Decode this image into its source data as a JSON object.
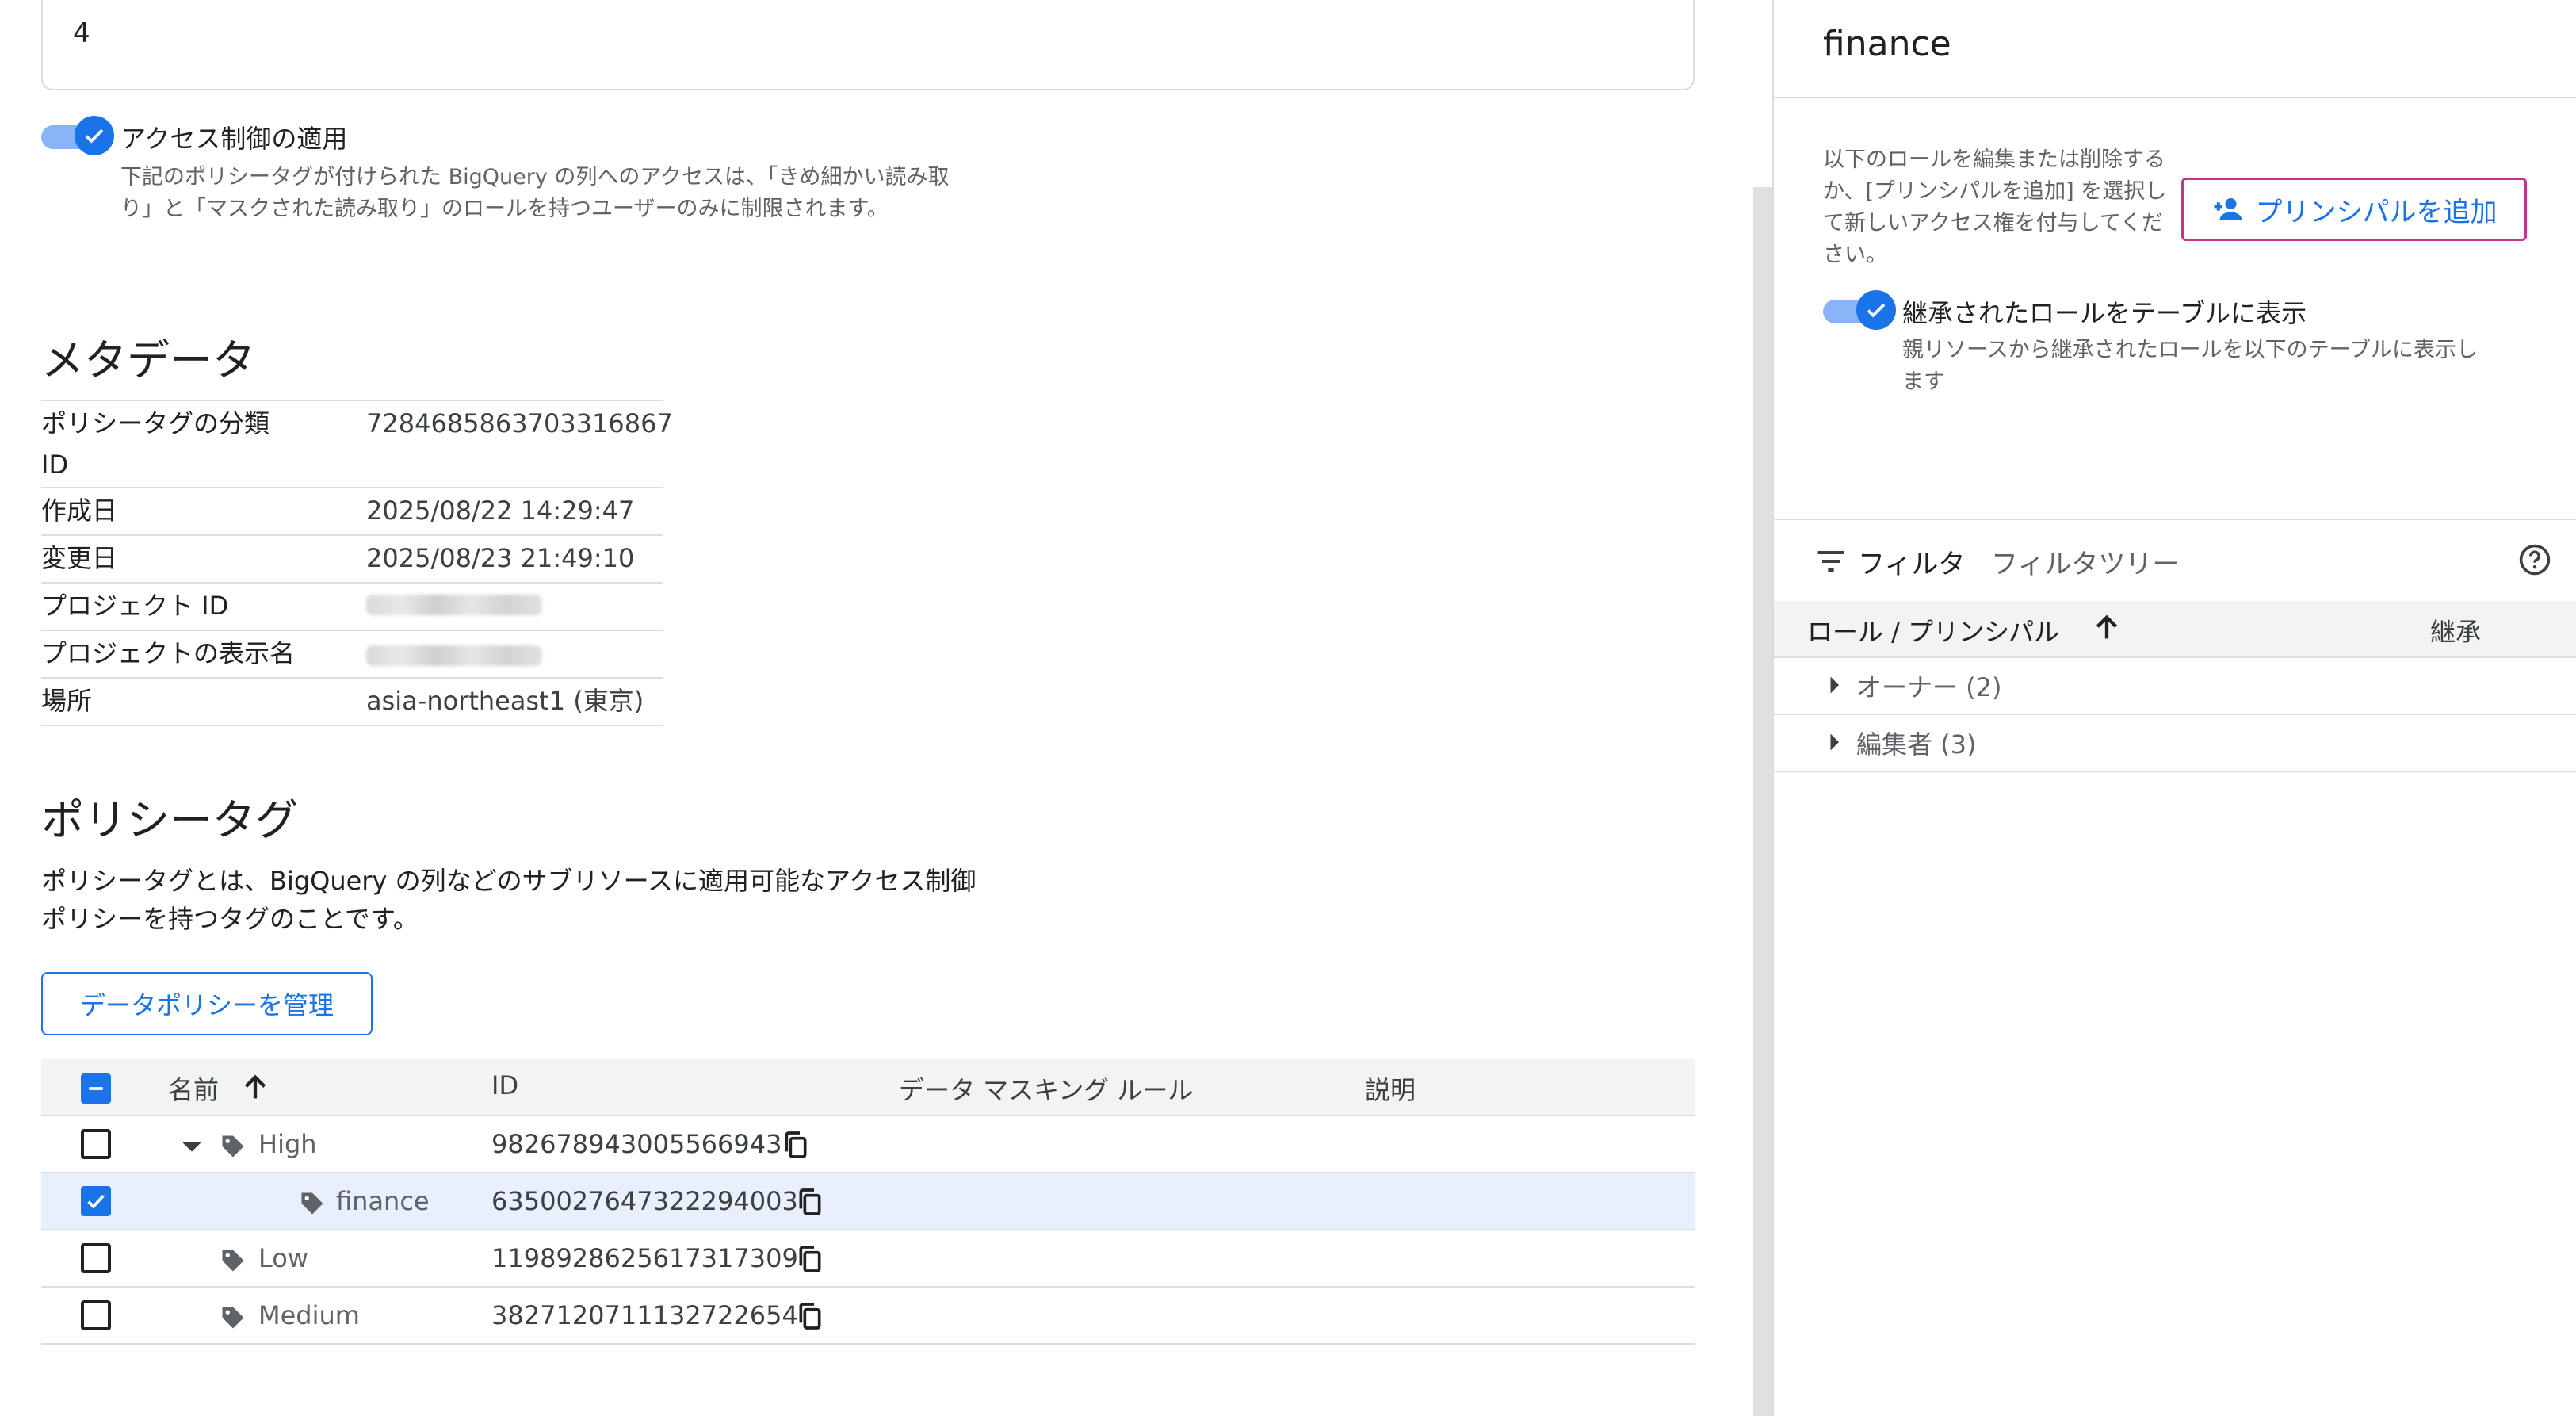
{
  "top_input": {
    "value": "4"
  },
  "access_control": {
    "title": "アクセス制御の適用",
    "description_line1": "下記のポリシータグが付けられた BigQuery の列へのアクセスは、「きめ細かい読み取",
    "description_line2": "り」と「マスクされた読み取り」のロールを持つユーザーのみに制限されます。",
    "enabled": true
  },
  "metadata": {
    "heading": "メタデータ",
    "rows": [
      {
        "key": "ポリシータグの分類",
        "key2": "ID",
        "value": "7284685863703316867"
      },
      {
        "key": "作成日",
        "value": "2025/08/22 14:29:47"
      },
      {
        "key": "変更日",
        "value": "2025/08/23 21:49:10"
      },
      {
        "key": "プロジェクト ID",
        "value": ""
      },
      {
        "key": "プロジェクトの表示名",
        "value": ""
      },
      {
        "key": "場所",
        "value": "asia-northeast1 (東京)"
      }
    ]
  },
  "policy_tags": {
    "heading": "ポリシータグ",
    "description_line1": "ポリシータグとは、BigQuery の列などのサブリソースに適用可能なアクセス制御",
    "description_line2": "ポリシーを持つタグのことです。",
    "manage_button": "データポリシーを管理",
    "columns": {
      "name": "名前",
      "id": "ID",
      "masking": "データ マスキング ルール",
      "description": "説明"
    },
    "rows": [
      {
        "name": "High",
        "id": "982678943005566943",
        "checked": false
      },
      {
        "name": "finance",
        "id": "6350027647322294003",
        "checked": true
      },
      {
        "name": "Low",
        "id": "1198928625617317309",
        "checked": false
      },
      {
        "name": "Medium",
        "id": "3827120711132722654",
        "checked": false
      }
    ]
  },
  "panel": {
    "title": "finance",
    "description": "以下のロールを編集または削除するか、[プリンシパルを追加] を選択して新しいアクセス権を付与してください。",
    "add_principal_button": "プリンシパルを追加",
    "inherited_toggle": {
      "title": "継承されたロールをテーブルに表示",
      "description_line1": "親リソースから継承されたロールを以下のテーブルに表示し",
      "description_line2": "ます",
      "enabled": true
    },
    "filter_label": "フィルタ",
    "filter_tree_label": "フィルタツリー",
    "columns": {
      "role": "ロール / プリンシパル",
      "inherit": "継承"
    },
    "roles": [
      {
        "label": "オーナー (2)"
      },
      {
        "label": "編集者 (3)"
      }
    ]
  },
  "colors": {
    "accent": "#1a73e8",
    "selected_row": "#e8f0fe",
    "focus_outline": "#c5338e"
  }
}
